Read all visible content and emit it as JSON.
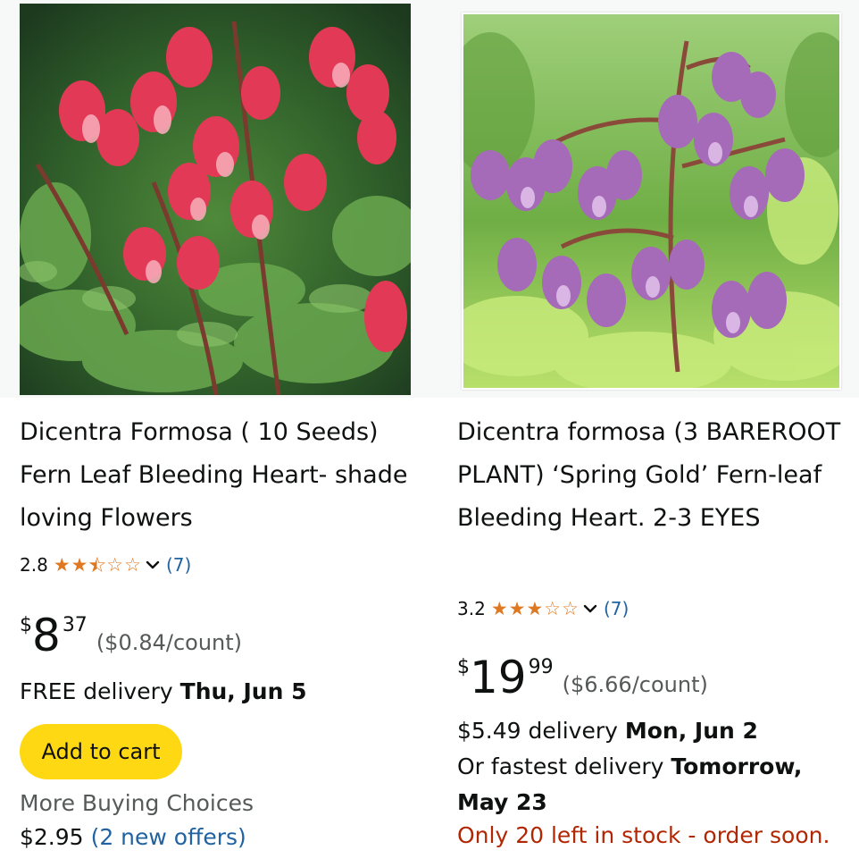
{
  "products": [
    {
      "title": "Dicentra Formosa ( 10 Seeds) Fern Leaf Bleeding Heart- shade loving Flowers",
      "rating": "2.8",
      "stars_value": 2.8,
      "review_count": "(7)",
      "price_symbol": "$",
      "price_whole": "8",
      "price_fraction": "37",
      "unit_price": "($0.84/count)",
      "delivery_prefix": "FREE delivery",
      "delivery_date": "Thu, Jun 5",
      "add_to_cart": "Add to cart",
      "more_choices": "More Buying Choices",
      "more_choices_price": "$2.95",
      "more_choices_offers": "(2 new offers)",
      "image_icon": "red-bleeding-heart-flower-photo"
    },
    {
      "title": "Dicentra formosa (3 BAREROOT PLANT) ‘Spring Gold’ Fern-leaf Bleeding Heart. 2-3 EYES",
      "rating": "3.2",
      "stars_value": 3.2,
      "review_count": "(7)",
      "price_symbol": "$",
      "price_whole": "19",
      "price_fraction": "99",
      "unit_price": "($6.66/count)",
      "delivery_prefix": "$5.49 delivery",
      "delivery_date": "Mon, Jun 2",
      "fastest_prefix": "Or fastest delivery",
      "fastest_date": "Tomorrow, May 23",
      "stock_note": "Only 20 left in stock - order soon.",
      "image_icon": "purple-bleeding-heart-flower-photo"
    }
  ],
  "colors": {
    "star": "#de7921",
    "link": "#2162a1",
    "button": "#ffd814",
    "stock_warning": "#b12704",
    "secondary_text": "#565959"
  }
}
